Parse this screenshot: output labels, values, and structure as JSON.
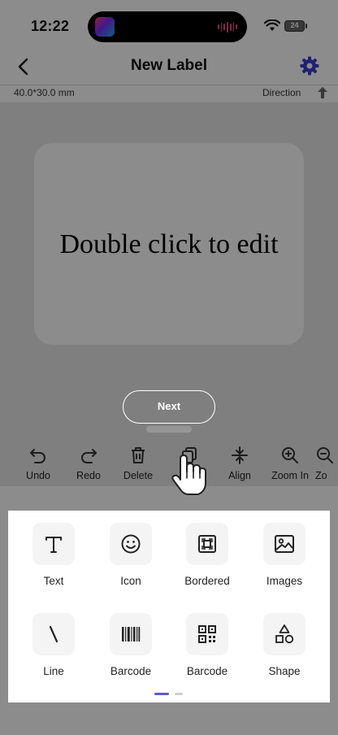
{
  "status_bar": {
    "time": "12:22",
    "battery": "24"
  },
  "header": {
    "title": "New Label"
  },
  "label_info": {
    "size": "40.0*30.0 mm",
    "direction_label": "Direction"
  },
  "canvas": {
    "placeholder_text": "Double click to edit"
  },
  "onboarding": {
    "next_label": "Next"
  },
  "toolbar": {
    "items": [
      {
        "label": "Undo",
        "icon": "undo-icon"
      },
      {
        "label": "Redo",
        "icon": "redo-icon"
      },
      {
        "label": "Delete",
        "icon": "trash-icon"
      },
      {
        "label": "Align",
        "icon": "align-icon"
      },
      {
        "label": "Zoom In",
        "icon": "zoom-in-icon"
      },
      {
        "label": "Zo",
        "icon": "zoom-out-icon"
      }
    ]
  },
  "elements_panel": {
    "items": [
      {
        "label": "Text",
        "icon": "text-icon"
      },
      {
        "label": "Icon",
        "icon": "smiley-icon"
      },
      {
        "label": "Bordered",
        "icon": "bordered-icon"
      },
      {
        "label": "Images",
        "icon": "image-icon"
      },
      {
        "label": "Line",
        "icon": "line-icon"
      },
      {
        "label": "Barcode",
        "icon": "barcode-icon"
      },
      {
        "label": "Barcode",
        "icon": "qrcode-icon"
      },
      {
        "label": "Shape",
        "icon": "shape-icon"
      }
    ],
    "active_page": 1,
    "page_count": 2
  },
  "colors": {
    "accent": "#5b5bd6",
    "overlay": "#000000"
  }
}
